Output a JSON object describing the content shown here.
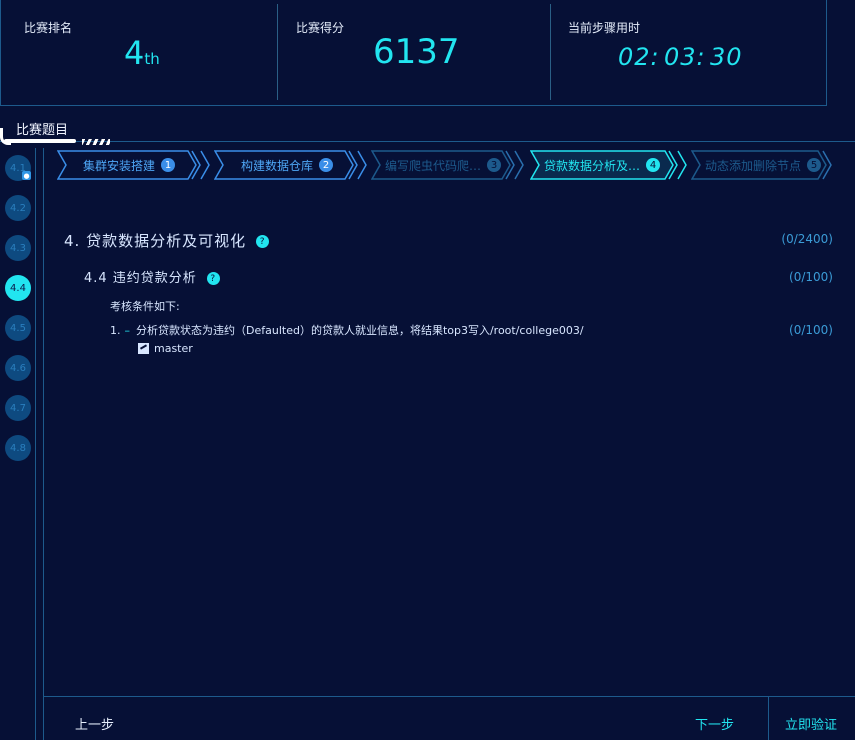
{
  "stats": {
    "rank_label": "比赛排名",
    "rank_value": "4",
    "rank_suffix": "th",
    "score_label": "比赛得分",
    "score_value": "6137",
    "time_label": "当前步骤用时",
    "time_h": "02:",
    "time_m": "03:",
    "time_s": "30"
  },
  "section_title": "比赛题目",
  "substeps": [
    "4.1",
    "4.2",
    "4.3",
    "4.4",
    "4.5",
    "4.6",
    "4.7",
    "4.8"
  ],
  "active_substep": "4.4",
  "tabs": [
    {
      "label": "集群安装搭建",
      "num": "1"
    },
    {
      "label": "构建数据仓库",
      "num": "2"
    },
    {
      "label": "编写爬虫代码爬…",
      "num": "3"
    },
    {
      "label": "贷款数据分析及…",
      "num": "4"
    },
    {
      "label": "动态添加删除节点",
      "num": "5"
    }
  ],
  "content": {
    "h1": "4. 贷款数据分析及可视化",
    "h1_score": "(0/2400)",
    "h2": "4.4 违约贷款分析",
    "h2_score": "(0/100)",
    "cond_label": "考核条件如下:",
    "item_num": "1.",
    "item_text": "分析贷款状态为违约（Defaulted）的贷款人就业信息，将结果top3写入/root/college003/",
    "item_score": "(0/100)",
    "branch": "master"
  },
  "footer": {
    "prev": "上一步",
    "next": "下一步",
    "verify": "立即验证"
  },
  "colors": {
    "accent": "#22e5f0",
    "bg": "#061036",
    "border": "#1d5a8c",
    "tab_blue": "#3a8ee8"
  }
}
